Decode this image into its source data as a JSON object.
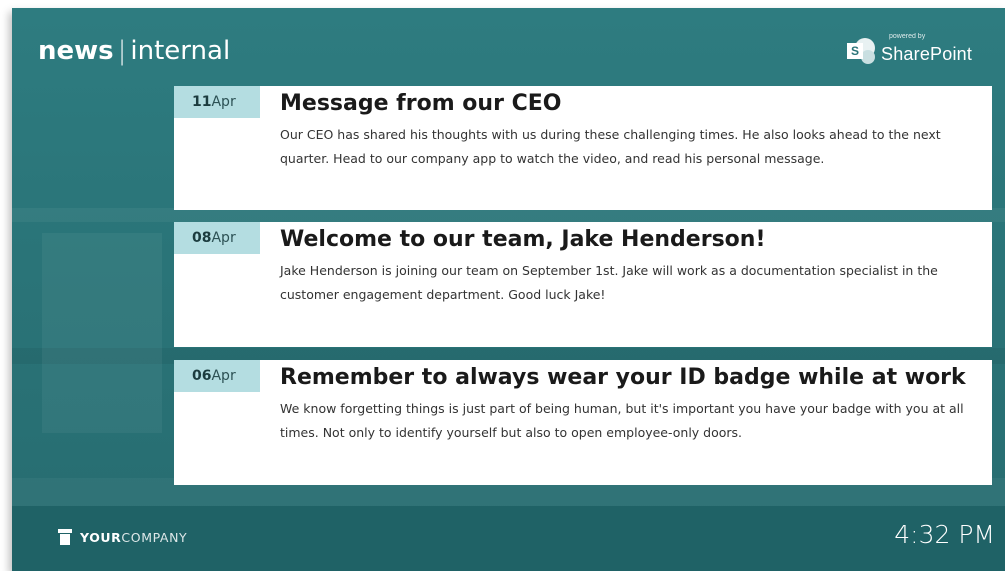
{
  "header": {
    "brand_bold": "news",
    "brand_separator": "|",
    "brand_light": "internal",
    "powered_by": "powered by",
    "powered_product": "SharePoint",
    "powered_icon_letter": "S"
  },
  "news": [
    {
      "day": "11",
      "month": "Apr",
      "title": "Message from our CEO",
      "body": "Our CEO has shared his thoughts with us during these challenging times. He also looks ahead to the next quarter. Head to our company app to watch the video, and read his personal message."
    },
    {
      "day": "08",
      "month": "Apr",
      "title": "Welcome to our team, Jake Henderson!",
      "body": "Jake Henderson is joining our team on September 1st. Jake will work as a documentation specialist in the customer engagement department. Good luck Jake!"
    },
    {
      "day": "06",
      "month": "Apr",
      "title": "Remember to always wear your ID badge while at work",
      "body": "We know forgetting things is just part of being human, but it's important you have your badge with you at all times. Not only to identify yourself but also to open employee-only doors."
    }
  ],
  "footer": {
    "logo_bold": "YOUR",
    "logo_light": "COMPANY",
    "time": "4:32 PM"
  },
  "colors": {
    "background_teal": "#2a7478",
    "footer_teal": "#1f6266",
    "date_tag": "#b4dde1",
    "card": "#ffffff"
  },
  "icons": {
    "provider_logo": "sharepoint-logo-icon",
    "company_logo": "company-logo-icon"
  }
}
